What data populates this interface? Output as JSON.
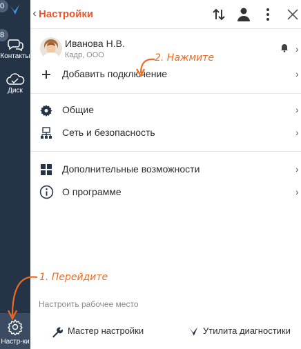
{
  "rail": {
    "top_badge": "0",
    "contacts_badge": "8",
    "contacts_label": "Контакты",
    "disk_label": "Диск",
    "settings_label": "Настр-ки"
  },
  "header": {
    "title": "Настройки"
  },
  "account": {
    "name": "Иванова Н.В.",
    "subtitle": "Кадр, ООО"
  },
  "menu": {
    "add_connection": "Добавить подключение",
    "general": "Общие",
    "network": "Сеть и безопасность",
    "extras": "Дополнительные возможности",
    "about": "О программе"
  },
  "annotations": {
    "step1": "1. Перейдите",
    "step2": "2. Нажмите"
  },
  "footer": {
    "title": "Настроить рабочее место",
    "wizard": "Мастер настройки",
    "diagnostics": "Утилита диагностики"
  },
  "colors": {
    "accent": "#e8562a",
    "rail": "#253347",
    "annotation": "#f06a1e"
  }
}
